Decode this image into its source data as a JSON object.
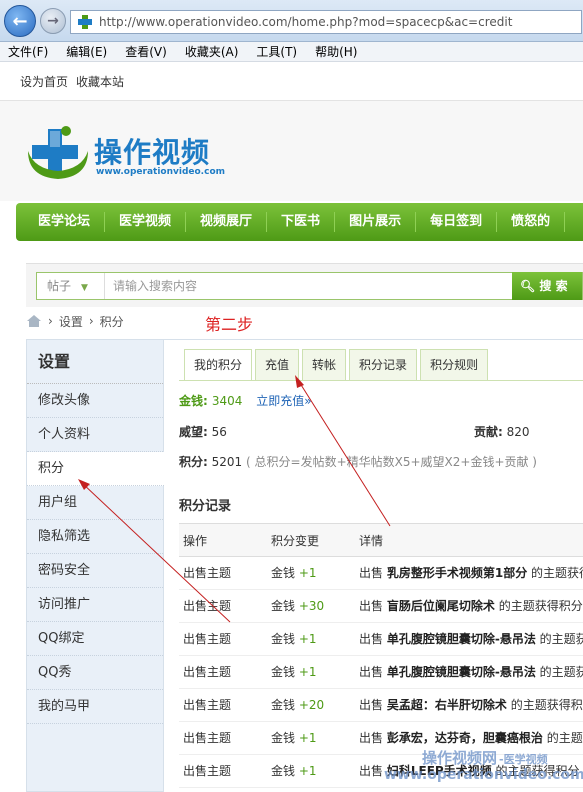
{
  "browser": {
    "url": "http://www.operationvideo.com/home.php?mod=spacecp&ac=credit",
    "menu": [
      "文件(F)",
      "编辑(E)",
      "查看(V)",
      "收藏夹(A)",
      "工具(T)",
      "帮助(H)"
    ]
  },
  "topbar": {
    "set_home": "设为首页",
    "bookmark": "收藏本站"
  },
  "logo": {
    "title": "操作视频",
    "url": "www.operationvideo.com"
  },
  "nav": [
    "医学论坛",
    "医学视频",
    "视频展厅",
    "下医书",
    "图片展示",
    "每日签到",
    "愤怒的"
  ],
  "search": {
    "type": "帖子",
    "placeholder": "请输入搜索内容",
    "button": "搜 索"
  },
  "breadcrumb": {
    "settings": "设置",
    "credit": "积分",
    "sep": "›"
  },
  "annotation": "第二步",
  "sidebar": {
    "title": "设置",
    "items": [
      "修改头像",
      "个人资料",
      "积分",
      "用户组",
      "隐私筛选",
      "密码安全",
      "访问推广",
      "QQ绑定",
      "QQ秀",
      "我的马甲"
    ]
  },
  "tabs": [
    "我的积分",
    "充值",
    "转帐",
    "积分记录",
    "积分规则"
  ],
  "credit": {
    "money_label": "金钱:",
    "money_value": "3404",
    "recharge_link": "立即充值»",
    "prestige_label": "威望:",
    "prestige_value": "56",
    "contrib_label": "贡献:",
    "contrib_value": "820",
    "points_label": "积分:",
    "points_value": "5201",
    "formula": "( 总积分=发帖数+精华帖数X5+威望X2+金钱+贡献 )"
  },
  "records": {
    "title": "积分记录",
    "headers": [
      "操作",
      "积分变更",
      "详情"
    ],
    "rows": [
      {
        "op": "出售主题",
        "unit": "金钱",
        "change": "+1",
        "pre": "出售",
        "topic": "乳房整形手术视频第1部分",
        "post": "的主题获得"
      },
      {
        "op": "出售主题",
        "unit": "金钱",
        "change": "+30",
        "pre": "出售",
        "topic": "盲肠后位阑尾切除术",
        "post": "的主题获得积分"
      },
      {
        "op": "出售主题",
        "unit": "金钱",
        "change": "+1",
        "pre": "出售",
        "topic": "单孔腹腔镜胆囊切除-悬吊法",
        "post": "的主题获"
      },
      {
        "op": "出售主题",
        "unit": "金钱",
        "change": "+1",
        "pre": "出售",
        "topic": "单孔腹腔镜胆囊切除-悬吊法",
        "post": "的主题获"
      },
      {
        "op": "出售主题",
        "unit": "金钱",
        "change": "+20",
        "pre": "出售",
        "topic": "吴孟超：右半肝切除术",
        "post": "的主题获得积"
      },
      {
        "op": "出售主题",
        "unit": "金钱",
        "change": "+1",
        "pre": "出售",
        "topic": "彭承宏，达芬奇，胆囊癌根治",
        "post": "的主题"
      },
      {
        "op": "出售主题",
        "unit": "金钱",
        "change": "+1",
        "pre": "出售",
        "topic": "妇科LEEP手术视频",
        "post": "的主题获得积分"
      }
    ]
  },
  "watermark": {
    "line1": "操作视频网",
    "line1_sub": "-医学视频",
    "line2": "www.operationvideo.com"
  }
}
